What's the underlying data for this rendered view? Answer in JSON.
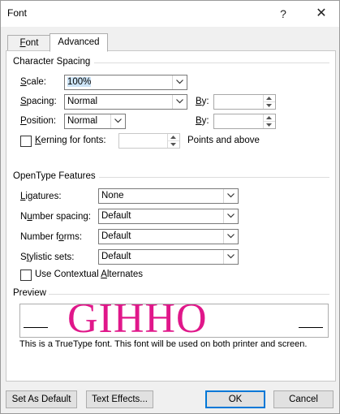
{
  "window": {
    "title": "Font",
    "help": "?",
    "close": "✕"
  },
  "tabs": {
    "font": "Font",
    "advanced": "Advanced"
  },
  "character_spacing": {
    "title": "Character Spacing",
    "scale_label": "Scale:",
    "scale_value": "100%",
    "spacing_label": "Spacing:",
    "spacing_value": "Normal",
    "by1_label": "By:",
    "position_label": "Position:",
    "position_value": "Normal",
    "by2_label": "By:",
    "kerning_label": "Kerning for fonts:",
    "points_label": "Points and above"
  },
  "opentype": {
    "title": "OpenType Features",
    "ligatures_label": "Ligatures:",
    "ligatures_value": "None",
    "number_spacing_label": "Number spacing:",
    "number_spacing_value": "Default",
    "number_forms_label": "Number forms:",
    "number_forms_value": "Default",
    "stylistic_sets_label": "Stylistic sets:",
    "stylistic_sets_value": "Default",
    "contextual_label": "Use Contextual Alternates"
  },
  "preview": {
    "title": "Preview",
    "sample_text": "GIHHO",
    "note": "This is a TrueType font. This font will be used on both printer and screen."
  },
  "buttons": {
    "set_default": "Set As Default",
    "text_effects": "Text Effects...",
    "ok": "OK",
    "cancel": "Cancel"
  },
  "colors": {
    "preview_text": "#e0178a",
    "ok_border": "#0078d7"
  }
}
